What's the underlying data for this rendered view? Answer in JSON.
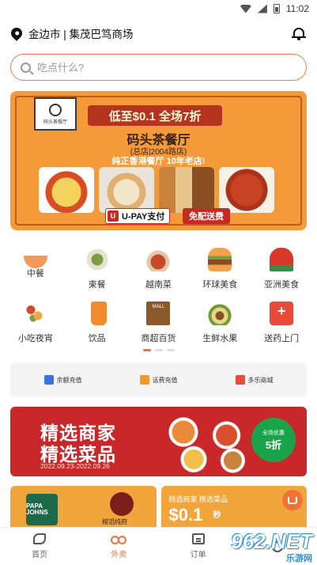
{
  "status_bar": {
    "time": "11:02"
  },
  "location": {
    "city": "金边市",
    "separator": "|",
    "place": "集茂巴笃商场"
  },
  "search": {
    "placeholder": "吃点什么?"
  },
  "banner": {
    "logo_text": "码头茶餐厅",
    "headline": "低至$0.1 全场7折",
    "shop_name": "码头茶餐厅",
    "branch": "(总店|2004路店)",
    "slogan": "纯正香港餐厅 10年老店!",
    "upay_label": "U-PAY支付",
    "free_delivery": "免配送费"
  },
  "categories": [
    {
      "label": "中餐",
      "icon": "bowl-icon"
    },
    {
      "label": "柬餐",
      "icon": "plate-icon"
    },
    {
      "label": "越南菜",
      "icon": "noodle-bowl-icon"
    },
    {
      "label": "环球美食",
      "icon": "burger-icon"
    },
    {
      "label": "亚洲美食",
      "icon": "asian-hat-icon"
    },
    {
      "label": "小吃夜宵",
      "icon": "skewer-icon"
    },
    {
      "label": "饮品",
      "icon": "drink-cup-icon"
    },
    {
      "label": "商超百货",
      "icon": "mall-icon"
    },
    {
      "label": "生鲜水果",
      "icon": "avocado-icon"
    },
    {
      "label": "送药上门",
      "icon": "medical-kit-icon"
    }
  ],
  "quick_links": [
    {
      "label": "余额充值",
      "color": "#3a73e0"
    },
    {
      "label": "话费充值",
      "color": "#f29a2a"
    },
    {
      "label": "多乐商城",
      "color": "#e94a3a"
    }
  ],
  "promo": {
    "line1": "精选商家",
    "line2": "精选菜品",
    "date_range": "2022.09.23-2022.09.26",
    "badge_top": "全场优惠",
    "badge_main": "5折"
  },
  "cards": {
    "left_brand": "PAPA JOHNS",
    "left_second": "榕滔炖府",
    "right_title": "精选商家 精选菜品",
    "right_price": "$0.1",
    "right_suffix": "秒"
  },
  "tabbar": {
    "items": [
      {
        "label": "首页",
        "active": false
      },
      {
        "label": "外卖",
        "active": true
      },
      {
        "label": "订单",
        "active": false
      }
    ]
  },
  "watermark": {
    "number": "962.NET",
    "text": "乐游网"
  },
  "colors": {
    "accent": "#f07238",
    "banner_bg": "#f49a3a",
    "promo_bg": "#c9282b"
  }
}
